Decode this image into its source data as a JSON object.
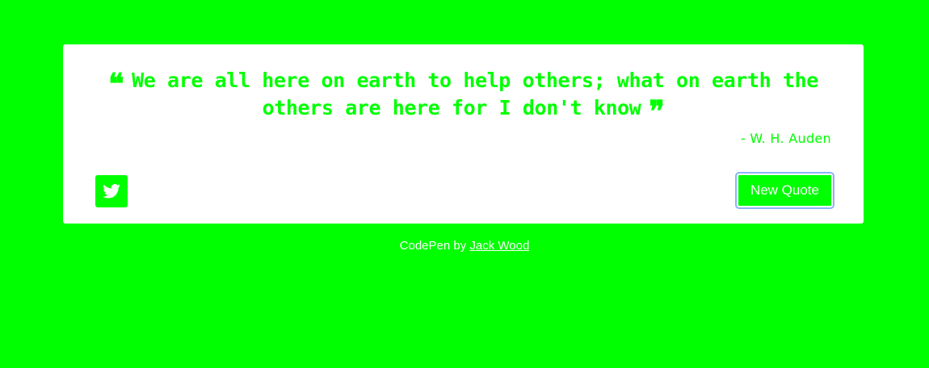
{
  "colors": {
    "background": "#00ff00",
    "card": "#ffffff",
    "accent": "#00ff00",
    "button_text": "#ffffff",
    "focus_ring": "#8ab4f8"
  },
  "quote": {
    "open_mark": "❝",
    "text": "We are all here on earth to help others; what on earth the others are here for I don't know",
    "close_mark": "❞",
    "author": "- W. H. Auden"
  },
  "actions": {
    "tweet_icon": "twitter-icon",
    "new_quote_label": "New Quote"
  },
  "footer": {
    "prefix": "CodePen by",
    "author_link": "Jack Wood"
  }
}
